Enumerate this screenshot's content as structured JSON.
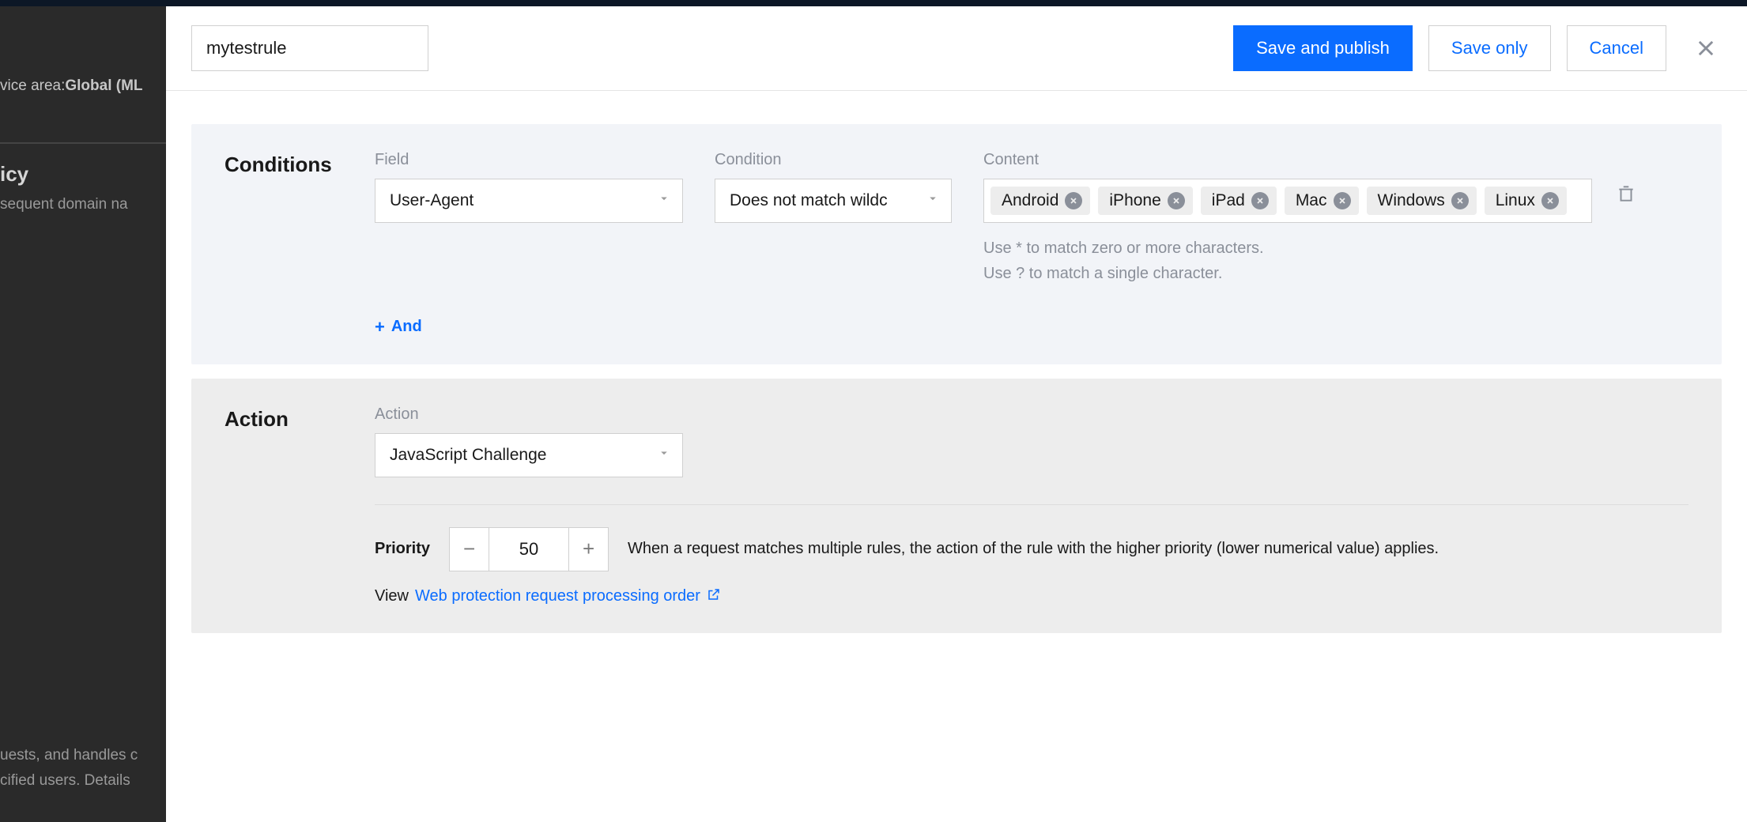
{
  "backdrop": {
    "service_area_label": "vice area:",
    "service_area_value": "Global (ML",
    "icy": "icy",
    "domain": "sequent domain na",
    "uests_line1": "uests, and handles c",
    "uests_line2": "cified users. Details"
  },
  "header": {
    "rule_name": "mytestrule",
    "save_publish": "Save and publish",
    "save_only": "Save only",
    "cancel": "Cancel"
  },
  "conditions": {
    "title": "Conditions",
    "field_label": "Field",
    "field_value": "User-Agent",
    "cond_label": "Condition",
    "cond_value": "Does not match wildc",
    "content_label": "Content",
    "tags": [
      "Android",
      "iPhone",
      "iPad",
      "Mac",
      "Windows",
      "Linux"
    ],
    "hint_line1": "Use * to match zero or more characters.",
    "hint_line2": "Use ? to match a single character.",
    "add_and": "And"
  },
  "action": {
    "title": "Action",
    "action_label": "Action",
    "action_value": "JavaScript Challenge",
    "priority_label": "Priority",
    "priority_value": "50",
    "priority_desc": "When a request matches multiple rules, the action of the rule with the higher priority (lower numerical value) applies.",
    "view_label": "View",
    "view_link": "Web protection request processing order"
  }
}
